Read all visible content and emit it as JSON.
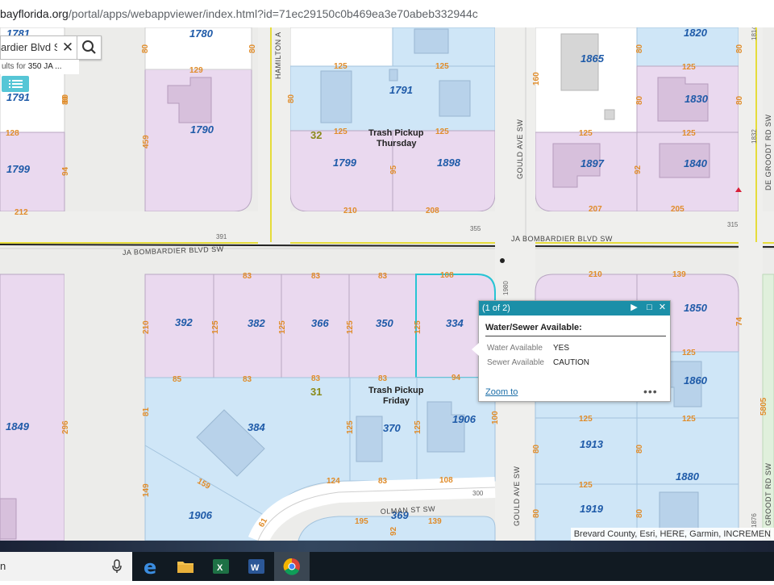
{
  "browser": {
    "url_domain": "bayflorida.org",
    "url_path": "/portal/apps/webappviewer/index.html?id=71ec29150c0b469ea3e70abeb332944c"
  },
  "search": {
    "value": "ardier Blvd SV",
    "results_prefix": "ults for ",
    "results_query": "350 JA ..."
  },
  "popup": {
    "counter": "(1 of 2)",
    "title": "Water/Sewer Available:",
    "fields": [
      {
        "label": "Water Available",
        "value": "YES"
      },
      {
        "label": "Sewer Available",
        "value": "CAUTION"
      }
    ],
    "zoom_label": "Zoom to",
    "more_label": "•••"
  },
  "attribution": "Brevard County, Esri, HERE, Garmin, INCREMEN",
  "map": {
    "parcels": {
      "p1781": "1781",
      "p1780": "1780",
      "p1820": "1820",
      "p1865": "1865",
      "p1791a": "1791",
      "p1791b": "1791",
      "p1830": "1830",
      "p1790": "1790",
      "p1799a": "1799",
      "p1799b": "1799",
      "p1898": "1898",
      "p1897": "1897",
      "p1840": "1840",
      "p392": "392",
      "p382": "382",
      "p366": "366",
      "p350": "350",
      "p334": "334",
      "p1850": "1850",
      "p1849": "1849",
      "p384": "384",
      "p370": "370",
      "p1906a": "1906",
      "p1860": "1860",
      "p1913": "1913",
      "p1880": "1880",
      "p1906b": "1906",
      "p369": "369",
      "p1919": "1919"
    },
    "streets": {
      "hamilton": "HAMILTON A",
      "gould_top": "GOULD AVE SW",
      "gould_bottom": "GOULD AVE SW",
      "degroot_top": "DE GROODT RD SW",
      "degroot_bottom": "DE GROODT RD SW",
      "bombardier_right": "JA BOMBARDIER BLVD SW",
      "bombardier_left": "JA BOMBARDIER BLVD SW",
      "olman": "OLMAN ST SW"
    },
    "trash_top": [
      "Trash Pickup",
      "Thursday"
    ],
    "trash_bottom": [
      "Trash Pickup",
      "Friday"
    ],
    "blocks": {
      "b32": "32",
      "b31": "31"
    },
    "dims": {
      "d1": "80",
      "d2": "80",
      "d3": "80",
      "d4": "80",
      "d5": "80",
      "d6": "80",
      "d7": "80",
      "d8": "125",
      "d9": "125",
      "d10": "129",
      "d11": "160",
      "d12": "125",
      "d13": "80",
      "d14": "80",
      "d15": "80",
      "d16": "128",
      "d17": "459",
      "d18": "125",
      "d19": "125",
      "d20": "125",
      "d21": "125",
      "d22": "94",
      "d23": "95",
      "d24": "92",
      "d25": "212",
      "d26": "210",
      "d27": "208",
      "d28": "207",
      "d29": "205",
      "d30": "83",
      "d31": "83",
      "d32": "83",
      "d33": "108",
      "d34": "210",
      "d35": "139",
      "d36": "210",
      "d37": "125",
      "d38": "125",
      "d39": "125",
      "d40": "125",
      "d41": "74",
      "d42": "85",
      "d43": "83",
      "d44": "83",
      "d45": "83",
      "d46": "94",
      "d47": "125",
      "d48": "296",
      "d49": "81",
      "d50": "125",
      "d51": "125",
      "d52": "100",
      "d53": "125",
      "d54": "125",
      "d55": "149",
      "d56": "159",
      "d57": "124",
      "d58": "83",
      "d59": "108",
      "d60": "80",
      "d61": "80",
      "d62": "125",
      "d63": "61",
      "d64": "195",
      "d65": "92",
      "d66": "139",
      "d67": "80",
      "d68": "80"
    },
    "nums": {
      "n391": "391",
      "n355": "355",
      "n315": "315",
      "n1980": "1980",
      "n1832": "1832",
      "n300": "300",
      "n5805": "5805",
      "n1876": "1876",
      "n1814": "1814"
    }
  },
  "taskbar": {
    "search_text": "n"
  }
}
